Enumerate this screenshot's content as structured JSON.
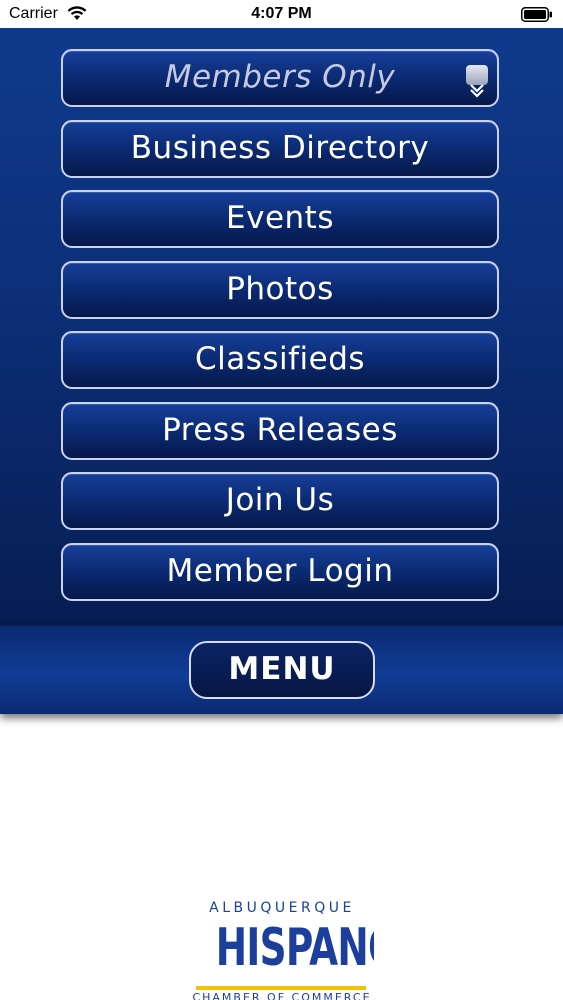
{
  "status_bar": {
    "carrier": "Carrier",
    "time": "4:07 PM",
    "icons": [
      "wifi-icon",
      "battery-icon"
    ]
  },
  "menu": {
    "header_label": "Members Only",
    "header_icon": "chevron-double-down-icon",
    "items": [
      {
        "label": "Business Directory"
      },
      {
        "label": "Events"
      },
      {
        "label": "Photos"
      },
      {
        "label": "Classifieds"
      },
      {
        "label": "Press Releases"
      },
      {
        "label": "Join Us"
      },
      {
        "label": "Member Login"
      }
    ]
  },
  "bottom_bar": {
    "menu_button_label": "MENU"
  },
  "logo": {
    "top_text": "ALBUQUERQUE",
    "main_text": "HISPANO",
    "sub_text": "CHAMBER OF COMMERCE"
  },
  "colors": {
    "panel_blue": "#0c2f78",
    "border_light": "#c9d2ee",
    "logo_blue": "#1c3f9c",
    "logo_yellow": "#f2c200"
  }
}
